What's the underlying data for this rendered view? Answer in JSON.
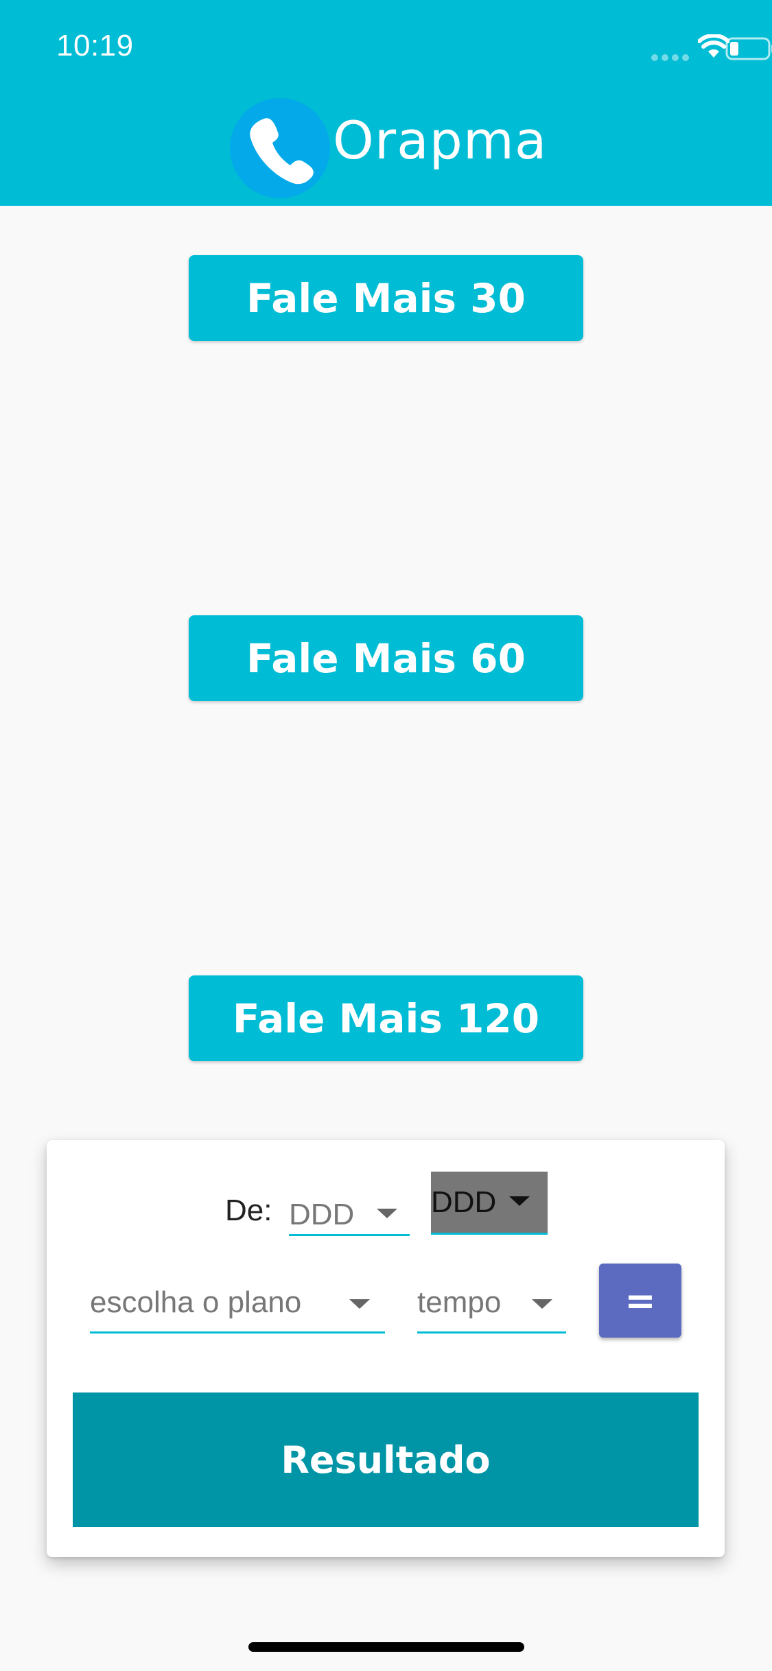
{
  "status_bar": {
    "time": "10:19",
    "icons": [
      "signal-icon",
      "wifi-icon",
      "battery-icon"
    ]
  },
  "app_bar": {
    "brand": "Orapma",
    "logo_icon": "phone-icon",
    "color": "#00bcd4"
  },
  "plans": [
    {
      "label": "Fale Mais 30"
    },
    {
      "label": "Fale Mais 60"
    },
    {
      "label": "Fale Mais 120"
    }
  ],
  "calculator": {
    "origin_label": "De:",
    "origin_ddd": "DDD",
    "destination_ddd": "DDD",
    "plan_placeholder": "escolha o plano",
    "time_placeholder": "tempo",
    "equals_label": "=",
    "result_label": "Resultado"
  },
  "colors": {
    "accent": "#00bcd4",
    "equals_button": "#5c6bc0",
    "result_button": "#0095a6"
  }
}
